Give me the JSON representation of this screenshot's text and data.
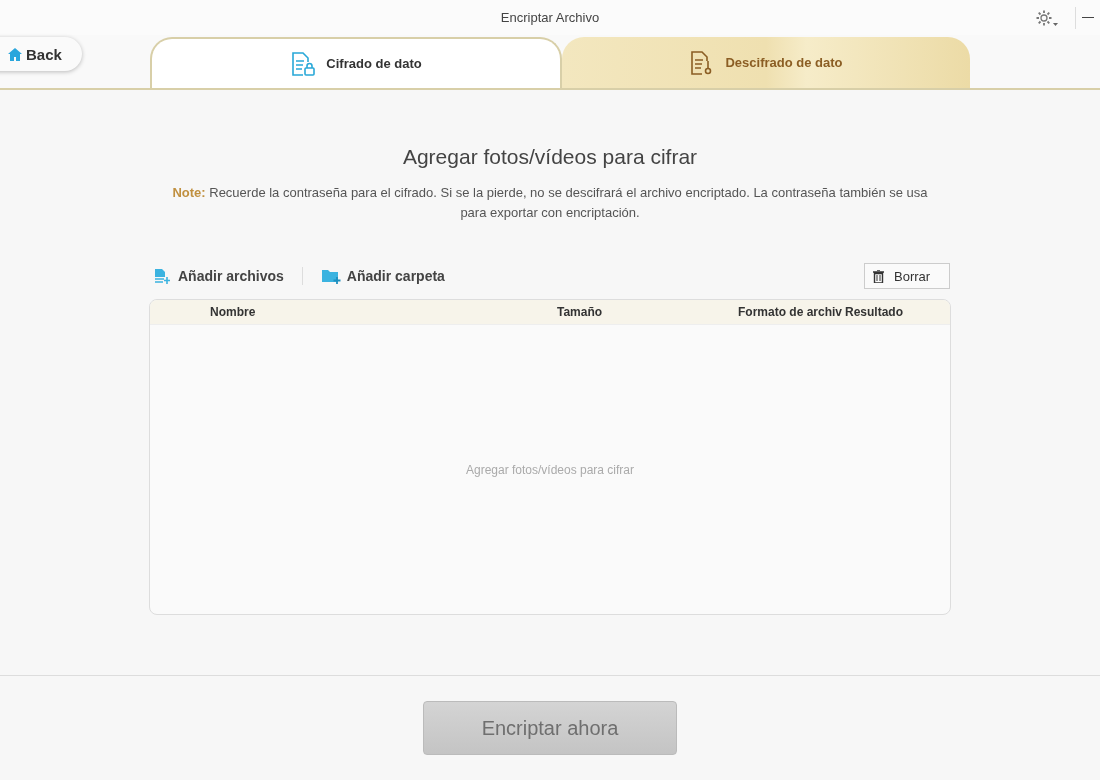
{
  "window": {
    "title": "Encriptar Archivo"
  },
  "back_button": {
    "label": "Back"
  },
  "tabs": [
    {
      "label": "Cifrado de dato",
      "selected": true,
      "kind": "lock"
    },
    {
      "label": "Descifrado de dato",
      "selected": false,
      "kind": "key"
    }
  ],
  "heading": "Agregar fotos/vídeos para cifrar",
  "note": "**Note:** Recuerde la contraseña para el cifrado. Si se la pierde, no se descifrará el archivo encriptado. La contraseña también se usa para exportar con encriptación.",
  "toolbar": {
    "add_files": "Añadir archivos",
    "add_folder": "Añadir carpeta",
    "delete": "Borrar"
  },
  "table": {
    "columns": [
      "Nombre",
      "Tamaño",
      "Formato de archiv",
      "Resultado"
    ],
    "empty_text": "Agregar fotos/vídeos para cifrar"
  },
  "encrypt_button": {
    "label": "Encriptar ahora",
    "disabled": true
  }
}
